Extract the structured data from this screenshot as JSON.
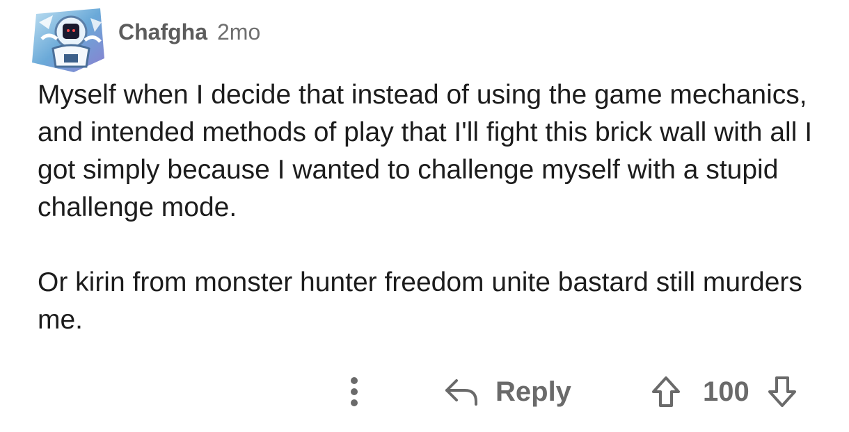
{
  "comment": {
    "author": "Chafgha",
    "age": "2mo",
    "paragraphs": [
      "Myself when I decide that instead of using the game mechanics, and intended methods of play that I'll fight this brick wall with all I got simply because I wanted to challenge myself with a stupid challenge mode.",
      "Or kirin from monster hunter freedom unite bastard still murders me."
    ]
  },
  "actions": {
    "more_icon": "vertical-ellipsis-icon",
    "reply_icon": "reply-arrow-icon",
    "reply_label": "Reply",
    "upvote_icon": "upvote-arrow-icon",
    "score": "100",
    "downvote_icon": "downvote-arrow-icon"
  },
  "colors": {
    "text": "#1c1c1c",
    "meta": "#6f6f6f",
    "action": "#6a6a6a",
    "background": "#ffffff"
  }
}
